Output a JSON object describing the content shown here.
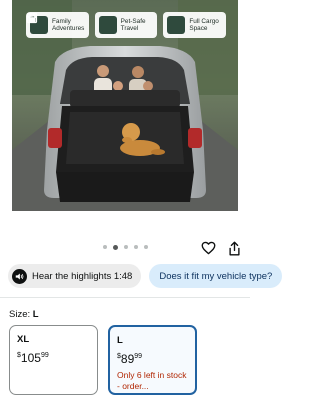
{
  "product_image": {
    "features": [
      {
        "icon": "family-icon",
        "line1": "Family",
        "line2": "Adventures"
      },
      {
        "icon": "paw-icon",
        "line1": "Pet-Safe",
        "line2": "Travel"
      },
      {
        "icon": "cargo-icon",
        "line1": "Full Cargo",
        "line2": "Space"
      }
    ],
    "carousel_dots": 5,
    "active_dot": 1
  },
  "actions": {
    "favorite_icon": "heart-icon",
    "share_icon": "share-icon"
  },
  "chips": {
    "audio_label": "Hear the highlights 1:48",
    "question_label": "Does it fit my vehicle type?"
  },
  "size": {
    "label": "Size:",
    "selected": "L",
    "options": [
      {
        "name": "XL",
        "currency": "$",
        "whole": "105",
        "cents": "99",
        "stock": ""
      },
      {
        "name": "L",
        "currency": "$",
        "whole": "89",
        "cents": "99",
        "stock": "Only 6 left in stock - order..."
      }
    ]
  },
  "colors": {
    "accent_selected": "#2162a1",
    "stock_warning": "#b12704",
    "question_chip": "#d9ecfb"
  }
}
